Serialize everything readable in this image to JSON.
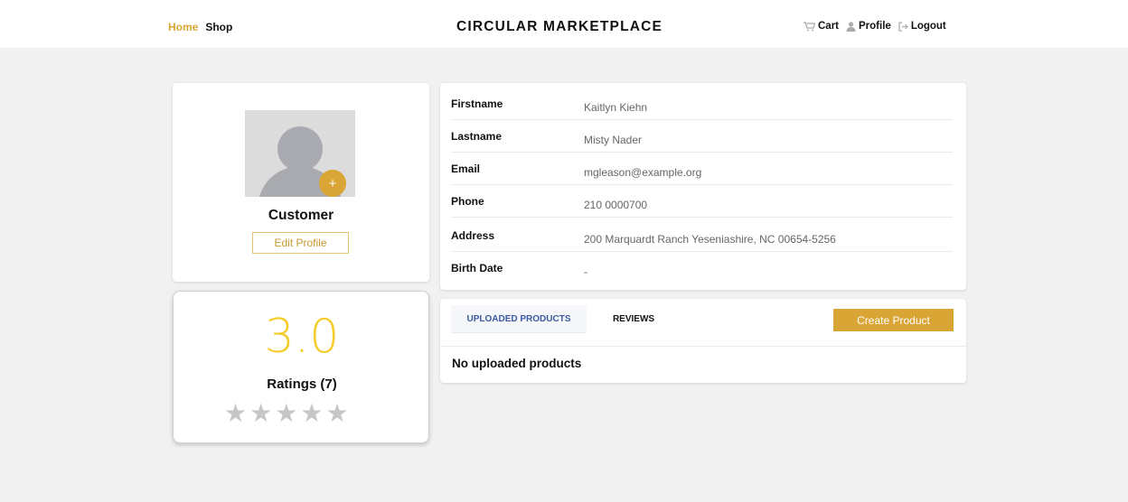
{
  "nav": {
    "home": "Home",
    "shop": "Shop",
    "brand": "CIRCULAR MARKETPLACE",
    "cart": "Cart",
    "profile": "Profile",
    "logout": "Logout",
    "cart_icon": "cart-icon",
    "profile_icon": "user-icon",
    "logout_icon": "logout-icon",
    "accent_color": "#d9a534"
  },
  "profile": {
    "avatar_icon": "default-avatar-icon",
    "add_photo_label": "+",
    "role": "Customer",
    "edit_label": "Edit Profile"
  },
  "rating": {
    "value": "3.0",
    "label": "Ratings (7)",
    "stars_filled": 0,
    "stars_total": 5,
    "value_color": "#f5cc28"
  },
  "info": [
    {
      "label": "Firstname",
      "value": "Kaitlyn Kiehn"
    },
    {
      "label": "Lastname",
      "value": "Misty Nader"
    },
    {
      "label": "Email",
      "value": "mgleason@example.org"
    },
    {
      "label": "Phone",
      "value": "210 0000700"
    },
    {
      "label": "Address",
      "value": "200 Marquardt Ranch Yeseniashire, NC 00654-5256"
    },
    {
      "label": "Birth Date",
      "value": "-"
    }
  ],
  "products": {
    "tab_uploaded": "UPLOADED PRODUCTS",
    "tab_reviews": "REVIEWS",
    "create_label": "Create Product",
    "empty_text": "No uploaded products"
  }
}
